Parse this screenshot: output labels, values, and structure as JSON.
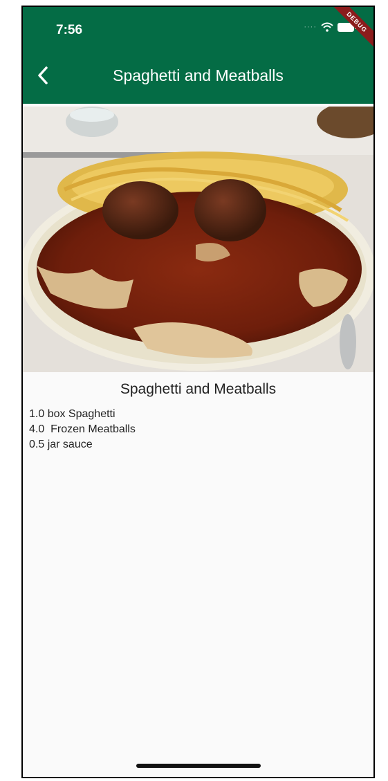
{
  "status_bar": {
    "time": "7:56",
    "debug_label": "DEBUG"
  },
  "app_bar": {
    "title": "Spaghetti and Meatballs"
  },
  "recipe": {
    "title": "Spaghetti and Meatballs",
    "ingredients": [
      "1.0 box Spaghetti",
      "4.0  Frozen Meatballs",
      "0.5 jar sauce"
    ]
  },
  "colors": {
    "app_bar": "#046c45",
    "background": "#fafafa"
  },
  "icons": {
    "back": "chevron-left-icon",
    "wifi": "wifi-icon",
    "battery": "battery-icon"
  }
}
